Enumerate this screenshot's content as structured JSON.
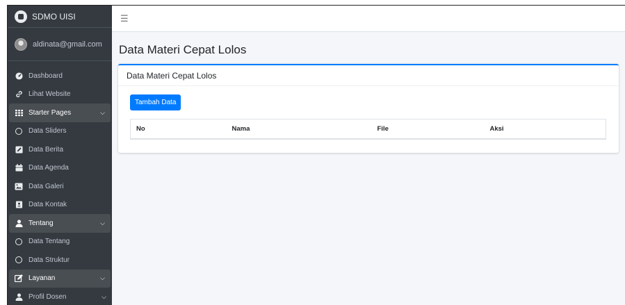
{
  "brand": {
    "name": "SDMO UISI"
  },
  "user": {
    "email": "aldinata@gmail.com"
  },
  "sidebar": {
    "items": [
      {
        "label": "Dashboard",
        "icon": "tachometer-icon"
      },
      {
        "label": "Lihat Website",
        "icon": "link-icon"
      },
      {
        "label": "Starter Pages",
        "icon": "th-icon",
        "expanded": true
      },
      {
        "label": "Data Sliders",
        "icon": "circle-outline-icon"
      },
      {
        "label": "Data Berita",
        "icon": "edit-square-icon"
      },
      {
        "label": "Data Agenda",
        "icon": "calendar-icon"
      },
      {
        "label": "Data Galeri",
        "icon": "image-icon"
      },
      {
        "label": "Data Kontak",
        "icon": "contact-card-icon"
      },
      {
        "label": "Tentang",
        "icon": "user-icon",
        "expanded": true
      },
      {
        "label": "Data Tentang",
        "icon": "circle-outline-icon"
      },
      {
        "label": "Data Struktur",
        "icon": "circle-outline-icon"
      },
      {
        "label": "Layanan",
        "icon": "edit-icon",
        "expanded": true
      },
      {
        "label": "Profil Dosen",
        "icon": "user-icon"
      }
    ]
  },
  "topbar": {
    "menu_icon": "hamburger-icon"
  },
  "page": {
    "title": "Data Materi Cepat Lolos"
  },
  "card": {
    "title": "Data Materi Cepat Lolos",
    "add_button": "Tambah Data",
    "table": {
      "columns": [
        "No",
        "Nama",
        "File",
        "Aksi"
      ]
    }
  },
  "colors": {
    "sidebar": "#343a40",
    "primary": "#007bff",
    "content_bg": "#f4f6f9"
  }
}
